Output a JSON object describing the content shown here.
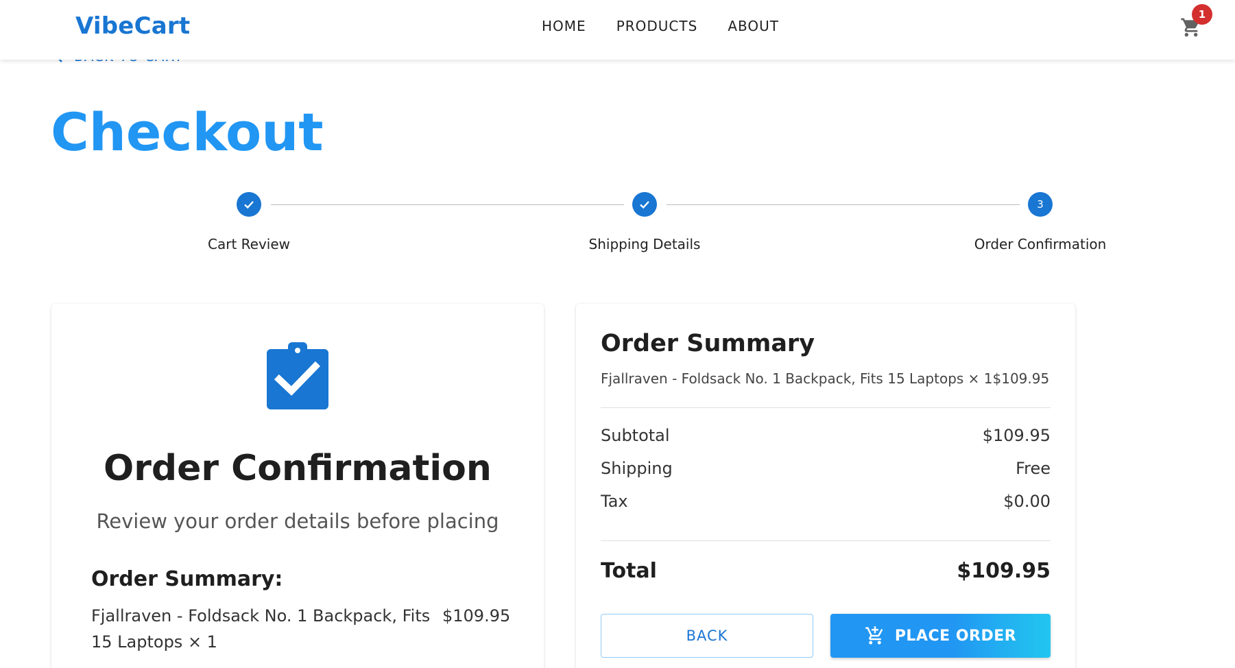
{
  "header": {
    "logo": "VibeCart",
    "nav": [
      "HOME",
      "PRODUCTS",
      "ABOUT"
    ],
    "cart_badge": "1",
    "cart_icon": "cart-icon"
  },
  "back_link": "BACK TO CART",
  "page_title": "Checkout",
  "stepper": {
    "steps": [
      {
        "label": "Cart Review",
        "status": "completed",
        "icon": "check-icon"
      },
      {
        "label": "Shipping Details",
        "status": "completed",
        "icon": "check-icon"
      },
      {
        "label": "Order Confirmation",
        "status": "active",
        "number": "3"
      }
    ]
  },
  "confirmation_card": {
    "icon": "clipboard-check-icon",
    "title": "Order Confirmation",
    "subtitle": "Review your order details before placing",
    "summary_title": "Order Summary:",
    "item_name": "Fjallraven - Foldsack No. 1 Backpack, Fits 15 Laptops × 1",
    "item_price": "$109.95"
  },
  "order_summary": {
    "title": "Order Summary",
    "item_line": "Fjallraven - Foldsack No. 1 Backpack, Fits 15 Laptops × 1$109.95",
    "subtotal_label": "Subtotal",
    "subtotal_value": "$109.95",
    "shipping_label": "Shipping",
    "shipping_value": "Free",
    "tax_label": "Tax",
    "tax_value": "$0.00",
    "total_label": "Total",
    "total_value": "$109.95",
    "back_button": "BACK",
    "place_order_button": "PLACE ORDER"
  },
  "colors": {
    "primary": "#1976d2",
    "title_blue": "#2196f3",
    "badge_red": "#d32f2f"
  }
}
